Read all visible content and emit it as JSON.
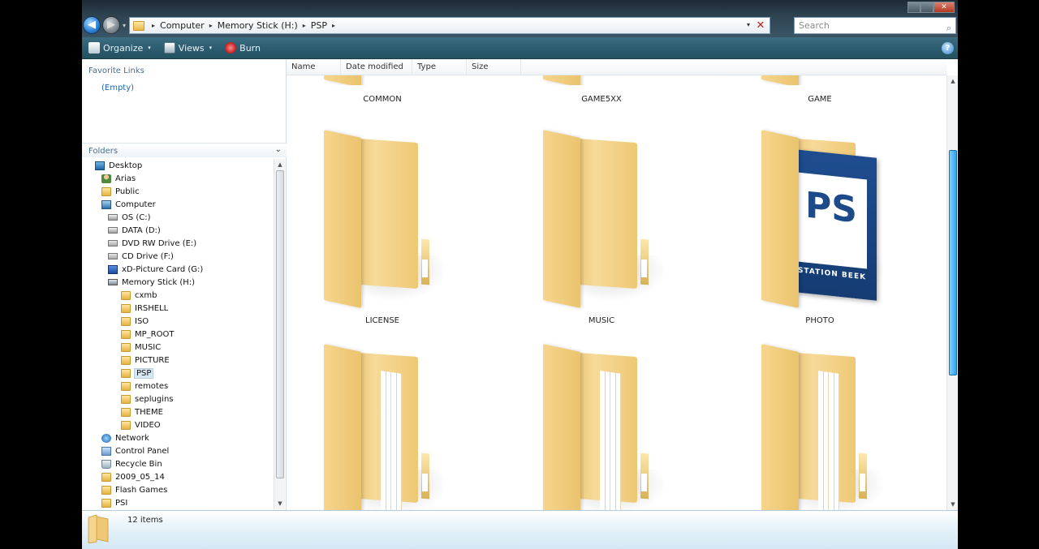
{
  "window": {
    "caption": {
      "min": "",
      "max": "",
      "close": "✕"
    },
    "nav": {
      "back_icon": "◀",
      "forward_icon": "▶",
      "dropdown_icon": "▾"
    },
    "address": {
      "segments": [
        "Computer",
        "Memory Stick (H:)",
        "PSP"
      ],
      "separator": "▸",
      "dropdown": "▾",
      "refresh": "✕"
    },
    "search": {
      "placeholder": "Search",
      "icon": "⌕"
    }
  },
  "toolbar": {
    "organize": "Organize",
    "views": "Views",
    "burn": "Burn",
    "dropdown": "▾",
    "help": "?"
  },
  "navpane": {
    "favorite_links_title": "Favorite Links",
    "favorite_empty": "(Empty)",
    "folders_title": "Folders",
    "folders_chevron": "⌄",
    "scroll_up": "▲",
    "scroll_down": "▼",
    "tree": [
      {
        "label": "Desktop",
        "icon": "desktop-icon"
      },
      {
        "label": "Arias",
        "icon": "user-folder-icon"
      },
      {
        "label": "Public",
        "icon": "folder-icon"
      },
      {
        "label": "Computer",
        "icon": "computer-icon"
      },
      {
        "label": "OS (C:)",
        "icon": "drive-icon"
      },
      {
        "label": "DATA (D:)",
        "icon": "drive-icon"
      },
      {
        "label": "DVD RW Drive (E:)",
        "icon": "dvd-drive-icon"
      },
      {
        "label": "CD Drive (F:)",
        "icon": "cd-drive-icon"
      },
      {
        "label": "xD-Picture Card (G:)",
        "icon": "card-icon"
      },
      {
        "label": "Memory Stick (H:)",
        "icon": "memory-stick-icon"
      },
      {
        "label": "cxmb",
        "icon": "folder-icon"
      },
      {
        "label": "IRSHELL",
        "icon": "folder-icon"
      },
      {
        "label": "ISO",
        "icon": "folder-icon"
      },
      {
        "label": "MP_ROOT",
        "icon": "folder-icon"
      },
      {
        "label": "MUSIC",
        "icon": "folder-icon"
      },
      {
        "label": "PICTURE",
        "icon": "folder-icon"
      },
      {
        "label": "PSP",
        "icon": "folder-icon",
        "selected": true
      },
      {
        "label": "remotes",
        "icon": "folder-icon"
      },
      {
        "label": "seplugins",
        "icon": "folder-icon"
      },
      {
        "label": "THEME",
        "icon": "folder-icon"
      },
      {
        "label": "VIDEO",
        "icon": "folder-icon"
      },
      {
        "label": "Network",
        "icon": "network-icon"
      },
      {
        "label": "Control Panel",
        "icon": "control-panel-icon"
      },
      {
        "label": "Recycle Bin",
        "icon": "recycle-bin-icon"
      },
      {
        "label": "2009_05_14",
        "icon": "folder-icon"
      },
      {
        "label": "Flash Games",
        "icon": "folder-icon"
      },
      {
        "label": "PSI",
        "icon": "folder-icon"
      }
    ]
  },
  "content": {
    "columns": [
      "Name",
      "Date modified",
      "Type",
      "Size"
    ],
    "scroll_up": "▲",
    "scroll_down": "▼",
    "items": [
      {
        "label": "COMMON",
        "icon": "folder-icon"
      },
      {
        "label": "GAME5XX",
        "icon": "folder-icon"
      },
      {
        "label": "GAME",
        "icon": "folder-icon"
      },
      {
        "label": "LICENSE",
        "icon": "folder-icon"
      },
      {
        "label": "MUSIC",
        "icon": "folder-icon"
      },
      {
        "label": "PHOTO",
        "icon": "playstation-folder-icon"
      },
      {
        "label": "",
        "icon": "folder-with-files-icon"
      },
      {
        "label": "",
        "icon": "folder-with-files-icon"
      },
      {
        "label": "",
        "icon": "folder-with-files-icon"
      }
    ],
    "photo_card": {
      "logo_glyph": "PS",
      "text": "STATION BEEK"
    }
  },
  "details": {
    "item_count": "12 items"
  },
  "colors": {
    "toolbar": "#2c5d72",
    "title": "#2f4452",
    "folder": "#f2cd7c",
    "selection": "#d9e8f5",
    "scroll_thumb": "#2ea2f2"
  }
}
